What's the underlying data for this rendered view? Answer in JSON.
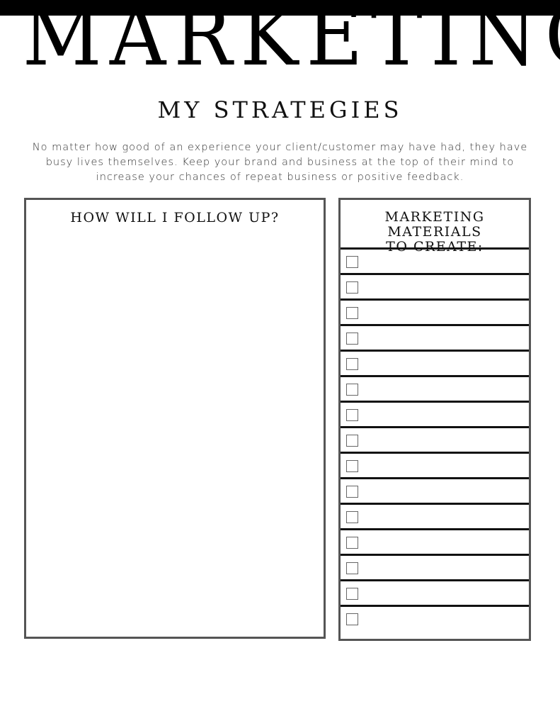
{
  "header": {
    "title": "MARKETING",
    "subtitle": "MY STRATEGIES"
  },
  "intro": {
    "text": "No matter how good of an experience your client/customer may have had, they have busy lives themselves. Keep your brand and business at the top of their mind to increase your chances of repeat business or positive feedback."
  },
  "followup": {
    "title": "HOW WILL I FOLLOW UP?",
    "notes_value": ""
  },
  "materials": {
    "title_line1": "MARKETING MATERIALS",
    "title_line2": "TO CREATE:",
    "items": [
      {
        "checked": false
      },
      {
        "checked": false
      },
      {
        "checked": false
      },
      {
        "checked": false
      },
      {
        "checked": false
      },
      {
        "checked": false
      },
      {
        "checked": false
      },
      {
        "checked": false
      },
      {
        "checked": false
      },
      {
        "checked": false
      },
      {
        "checked": false
      },
      {
        "checked": false
      },
      {
        "checked": false
      },
      {
        "checked": false
      },
      {
        "checked": false
      }
    ]
  },
  "colors": {
    "top_bar": "#000000",
    "border": "#555555",
    "text": "#111111"
  }
}
